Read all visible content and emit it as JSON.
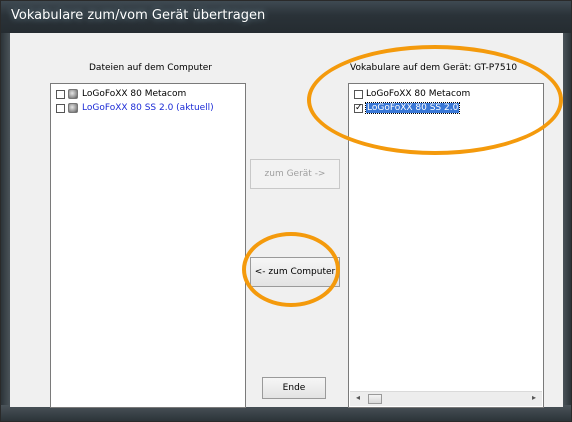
{
  "window": {
    "title": "Vokabulare zum/vom Gerät übertragen"
  },
  "left_panel": {
    "caption": "Dateien auf dem Computer",
    "items": [
      {
        "label": "LoGoFoXX 80 Metacom",
        "checked": false
      },
      {
        "label": "LoGoFoXX 80 SS 2.0 (aktuell)",
        "checked": false
      }
    ]
  },
  "right_panel": {
    "caption": "Vokabulare auf dem Gerät: GT-P7510",
    "items": [
      {
        "label": "LoGoFoXX 80 Metacom",
        "checked": false
      },
      {
        "label": "LoGoFoXX 80 SS 2.0",
        "checked": true
      }
    ],
    "scroll_left": "◂",
    "scroll_right": "▸"
  },
  "buttons": {
    "to_device": "zum Gerät ->",
    "to_computer": "<- zum Computer",
    "end": "Ende"
  },
  "check_mark": "✓",
  "colors": {
    "highlight": "#f49a0c",
    "link_blue": "#1b2bd6",
    "selection": "#3a78d6"
  }
}
